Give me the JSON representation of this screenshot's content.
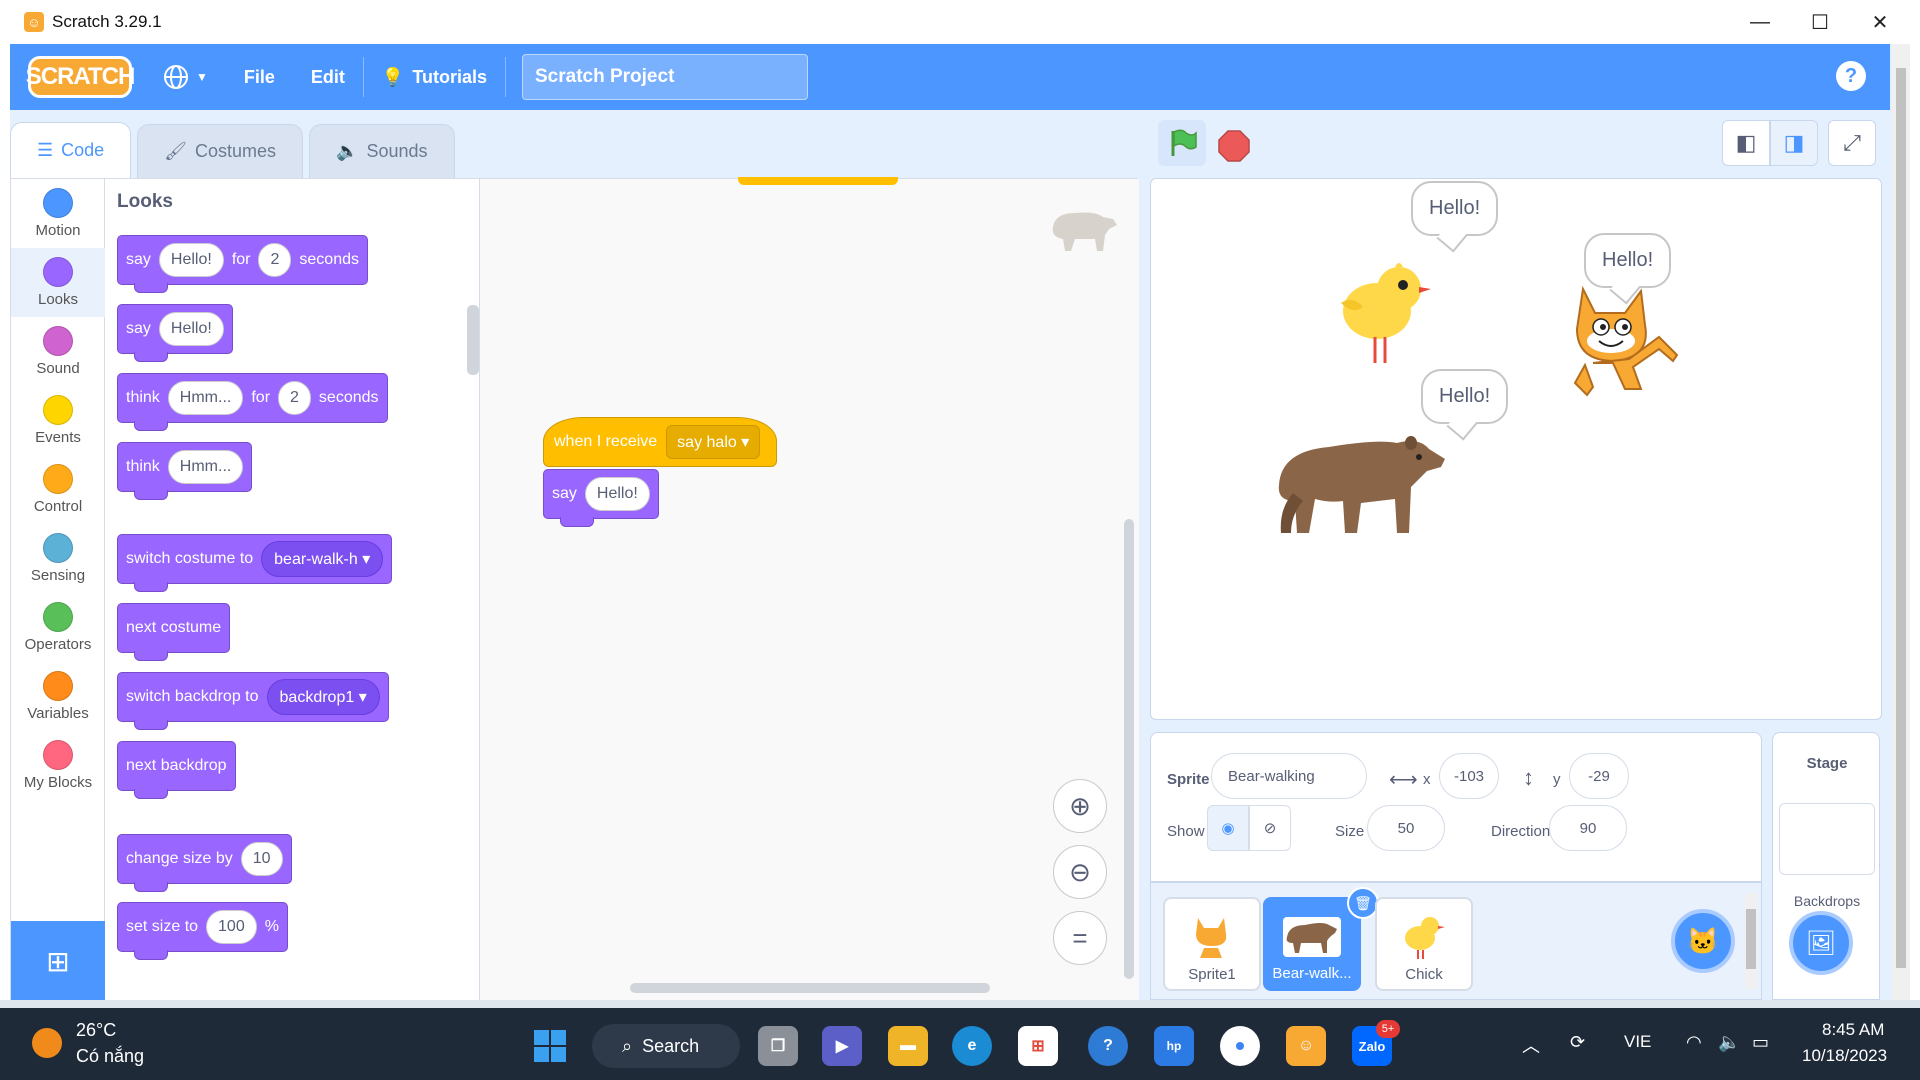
{
  "window": {
    "title": "Scratch 3.29.1",
    "minimize": "—",
    "maximize": "☐",
    "close": "✕"
  },
  "menubar": {
    "logo": "SCRATCH",
    "file": "File",
    "edit": "Edit",
    "tutorials": "Tutorials",
    "project_title": "Scratch Project",
    "help": "?"
  },
  "tabs": {
    "code": "Code",
    "costumes": "Costumes",
    "sounds": "Sounds"
  },
  "categories": [
    {
      "label": "Motion",
      "color": "#4c97ff"
    },
    {
      "label": "Looks",
      "color": "#9966ff"
    },
    {
      "label": "Sound",
      "color": "#cf63cf"
    },
    {
      "label": "Events",
      "color": "#ffd500"
    },
    {
      "label": "Control",
      "color": "#ffab19"
    },
    {
      "label": "Sensing",
      "color": "#5cb1d6"
    },
    {
      "label": "Operators",
      "color": "#59c059"
    },
    {
      "label": "Variables",
      "color": "#ff8c1a"
    },
    {
      "label": "My Blocks",
      "color": "#ff6680"
    }
  ],
  "palette": {
    "heading": "Looks",
    "say_for": {
      "say": "say",
      "text": "Hello!",
      "for": "for",
      "secs": "2",
      "seconds": "seconds"
    },
    "say": {
      "say": "say",
      "text": "Hello!"
    },
    "think_for": {
      "think": "think",
      "text": "Hmm...",
      "for": "for",
      "secs": "2",
      "seconds": "seconds"
    },
    "think": {
      "think": "think",
      "text": "Hmm..."
    },
    "switch_costume": {
      "label": "switch costume to",
      "value": "bear-walk-h"
    },
    "next_costume": "next costume",
    "switch_backdrop": {
      "label": "switch backdrop to",
      "value": "backdrop1"
    },
    "next_backdrop": "next backdrop",
    "change_size": {
      "label": "change size by",
      "value": "10"
    },
    "set_size": {
      "label": "set size to",
      "value": "100",
      "unit": "%"
    }
  },
  "script": {
    "hat_label": "when I receive",
    "hat_message": "say halo",
    "say_label": "say",
    "say_text": "Hello!"
  },
  "stage": {
    "bubbles": [
      "Hello!",
      "Hello!",
      "Hello!"
    ]
  },
  "sprite_info": {
    "sprite_label": "Sprite",
    "sprite_name": "Bear-walking",
    "x_label": "x",
    "x_value": "-103",
    "y_label": "y",
    "y_value": "-29",
    "show_label": "Show",
    "size_label": "Size",
    "size_value": "50",
    "direction_label": "Direction",
    "direction_value": "90"
  },
  "sprites": [
    {
      "name": "Sprite1"
    },
    {
      "name": "Bear-walk..."
    },
    {
      "name": "Chick"
    }
  ],
  "stage_pane": {
    "title": "Stage",
    "backdrops": "Backdrops"
  },
  "taskbar": {
    "weather_temp": "26°C",
    "weather_text": "Có nắng",
    "search": "Search",
    "lang": "VIE",
    "time": "8:45 AM",
    "date": "10/18/2023",
    "zalo_badge": "5+",
    "zalo": "Zalo"
  }
}
